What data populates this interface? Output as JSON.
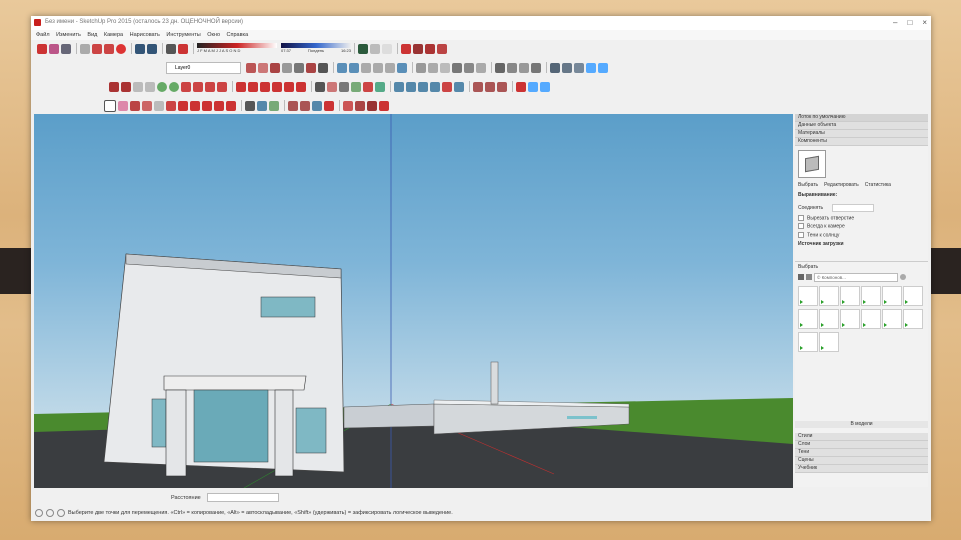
{
  "window": {
    "title": "Без имени - SketchUp Pro 2015 (осталось 23 дн. ОЦЕНОЧНОЙ версии)",
    "controls": [
      "–",
      "□",
      "×"
    ]
  },
  "menu": [
    "Файл",
    "Изменить",
    "Вид",
    "Камера",
    "Нарисовать",
    "Инструменты",
    "Окно",
    "Справка"
  ],
  "toolbars": {
    "layer_name": "Layer0",
    "shadow_label": "J F M A M J J A S O N D",
    "time_start": "07:37",
    "time_mid": "Полдень",
    "time_end": "16:23"
  },
  "panel": {
    "tray_title": "Лоток по умолчанию",
    "sections": [
      "Данные объекта",
      "Материалы",
      "Компоненты"
    ],
    "tabs": [
      "Выбрать",
      "Редактировать",
      "Статистика"
    ],
    "alignment_title": "Выравнивание:",
    "glue_label": "Соединять",
    "options": [
      "Вырезать отверстие",
      "Всегда к камере",
      "Тени к солнцу"
    ],
    "load_source": "Источник загрузки",
    "select_title": "Выбрать",
    "search_placeholder": "© Компонов...",
    "in_model": "В модели",
    "bottom_sections": [
      "Стили",
      "Слои",
      "Тени",
      "Сцены",
      "Учебник"
    ]
  },
  "status": {
    "measure_label": "Расстояние",
    "hint": "Выберите две точки для перемещения.  «Ctrl» = копирование, «Alt» = автоскладывание, «Shift» (удерживать) = зафиксировать логическое выведение."
  },
  "colors": {
    "sky": "#6aa9d1",
    "accent_red": "#c8201d",
    "watermark": "#7ae8dc"
  }
}
